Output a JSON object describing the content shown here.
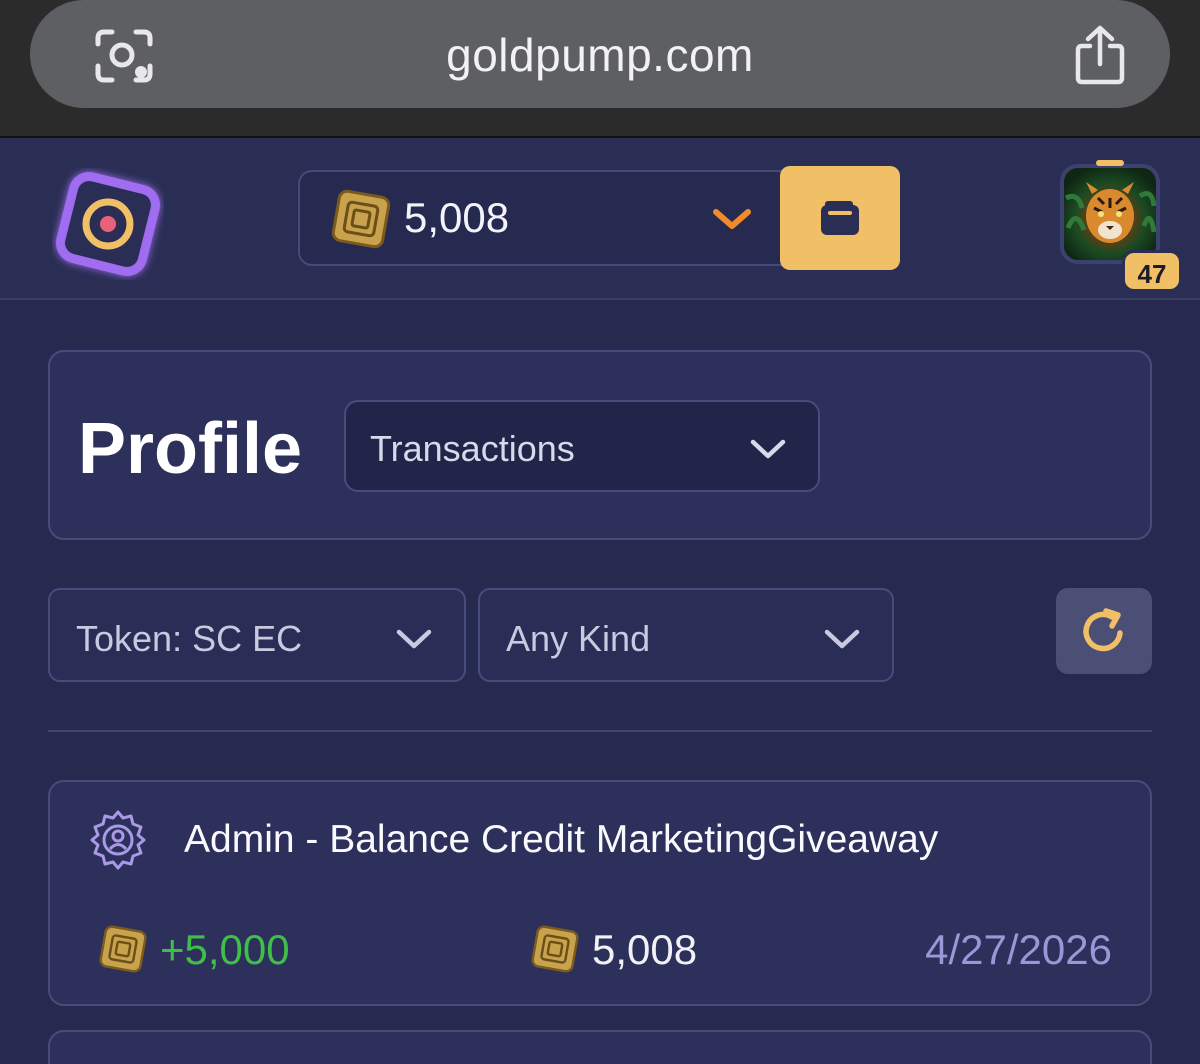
{
  "browser": {
    "url": "goldpump.com",
    "lens_icon": "visual-lookup-icon",
    "share_icon": "share-icon"
  },
  "header": {
    "logo_icon": "goldpump-logo-icon",
    "balance": "5,008",
    "balance_coin_icon": "gold-coin-icon",
    "dropdown_icon": "chevron-down-icon",
    "wallet_icon": "wallet-icon",
    "level": "47",
    "accent_color": "#f1bf66"
  },
  "profile": {
    "title": "Profile",
    "section_selected": "Transactions"
  },
  "filters": {
    "token": "Token: SC EC",
    "kind": "Any Kind",
    "refresh_icon": "refresh-icon"
  },
  "transactions": [
    {
      "icon": "admin-gear-icon",
      "title": "Admin - Balance Credit MarketingGiveaway",
      "amount": "+5,000",
      "balance": "5,008",
      "date": "4/27/2026",
      "amount_color": "#3fbf4a"
    }
  ]
}
